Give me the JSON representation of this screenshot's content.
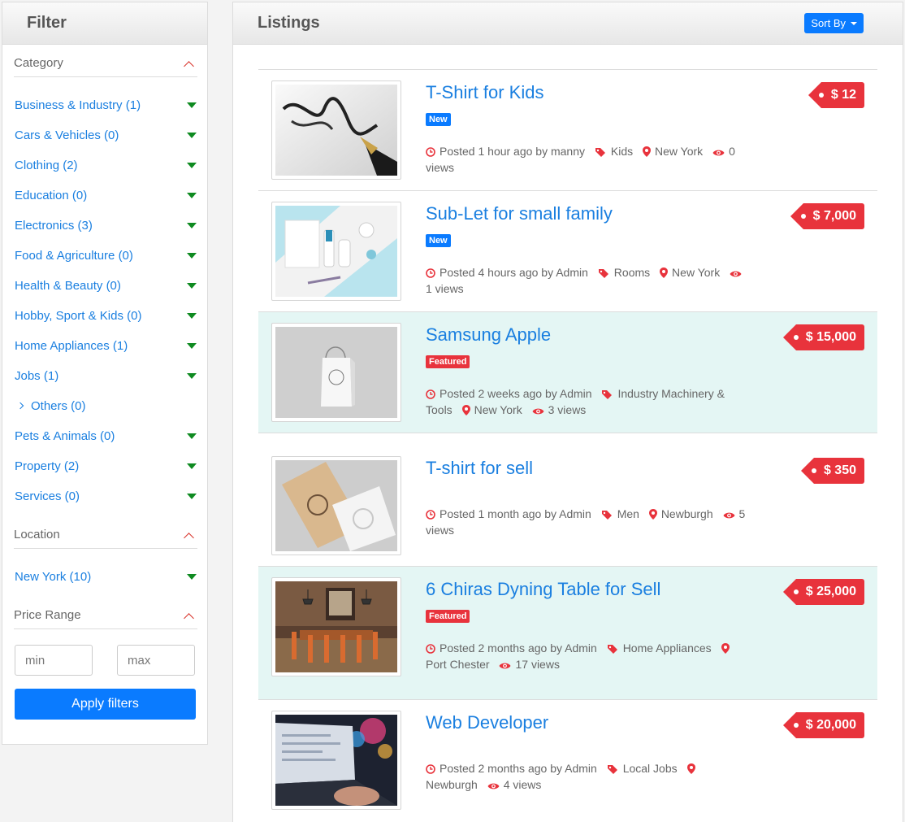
{
  "filter": {
    "title": "Filter",
    "category_label": "Category",
    "categories": [
      {
        "label": "Business & Industry (1)",
        "expand": "triangle"
      },
      {
        "label": "Cars & Vehicles (0)",
        "expand": "triangle"
      },
      {
        "label": "Clothing (2)",
        "expand": "triangle"
      },
      {
        "label": "Education (0)",
        "expand": "triangle"
      },
      {
        "label": "Electronics (3)",
        "expand": "triangle"
      },
      {
        "label": "Food & Agriculture (0)",
        "expand": "triangle"
      },
      {
        "label": "Health & Beauty (0)",
        "expand": "triangle"
      },
      {
        "label": "Hobby, Sport & Kids (0)",
        "expand": "triangle"
      },
      {
        "label": "Home Appliances (1)",
        "expand": "triangle"
      },
      {
        "label": "Jobs (1)",
        "expand": "triangle"
      },
      {
        "label": "Others (0)",
        "expand": "chevron"
      },
      {
        "label": "Pets & Animals (0)",
        "expand": "triangle"
      },
      {
        "label": "Property (2)",
        "expand": "triangle"
      },
      {
        "label": "Services (0)",
        "expand": "triangle"
      }
    ],
    "location_label": "Location",
    "locations": [
      {
        "label": "New York (10)"
      }
    ],
    "price_label": "Price Range",
    "min_placeholder": "min",
    "max_placeholder": "max",
    "apply_label": "Apply filters"
  },
  "listings_header": {
    "title": "Listings",
    "sort_label": "Sort By"
  },
  "listings": [
    {
      "title": "T-Shirt for Kids",
      "badge": "New",
      "price": "$ 12",
      "time": "Posted 1 hour ago by manny",
      "category": "Kids",
      "location": "New York",
      "views": "0 views",
      "featured": false
    },
    {
      "title": "Sub-Let for small family",
      "badge": "New",
      "price": "$ 7,000",
      "time": "Posted 4 hours ago by Admin",
      "category": "Rooms",
      "location": "New York",
      "views": "1 views",
      "featured": false
    },
    {
      "title": "Samsung Apple",
      "badge": "Featured",
      "price": "$ 15,000",
      "time": "Posted 2 weeks ago by Admin",
      "category": "Industry Machinery & Tools",
      "location": "New York",
      "views": "3 views",
      "featured": true
    },
    {
      "title": "T-shirt for sell",
      "badge": "",
      "price": "$ 350",
      "time": "Posted 1 month ago by Admin",
      "category": "Men",
      "location": "Newburgh",
      "views": "5 views",
      "featured": false
    },
    {
      "title": "6 Chiras Dyning Table for Sell",
      "badge": "Featured",
      "price": "$ 25,000",
      "time": "Posted 2 months ago by Admin",
      "category": "Home Appliances",
      "location": "Port Chester",
      "views": "17 views",
      "featured": true
    },
    {
      "title": "Web Developer",
      "badge": "",
      "price": "$ 20,000",
      "time": "Posted 2 months ago by Admin",
      "category": "Local Jobs",
      "location": "Newburgh",
      "views": "4 views",
      "featured": false
    }
  ],
  "colors": {
    "accent": "#0a7bff",
    "link": "#1a7fe0",
    "price": "#e8333c",
    "featured_bg": "#e4f6f4",
    "expand": "#0e8a20"
  }
}
